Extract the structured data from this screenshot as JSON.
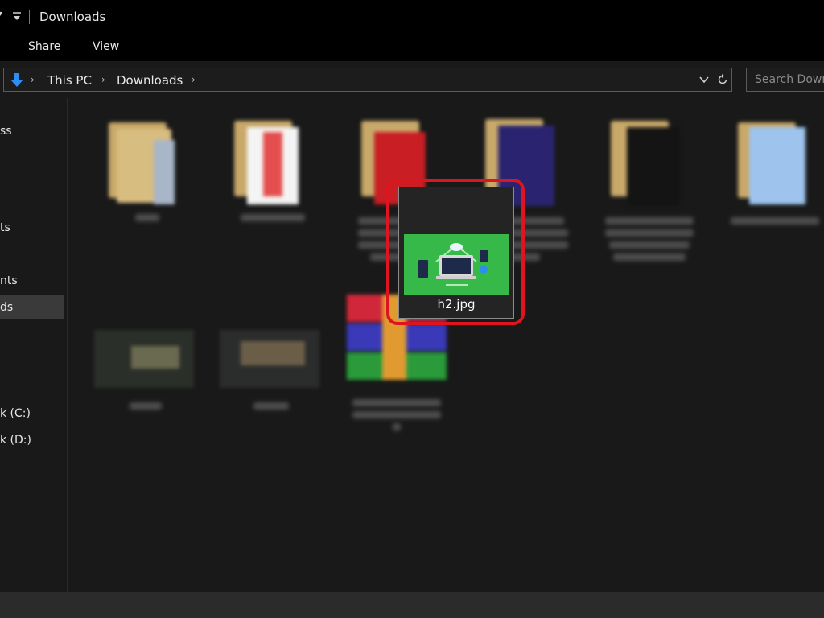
{
  "window": {
    "title": "Downloads"
  },
  "ribbon": {
    "tabs": [
      {
        "label": "Share"
      },
      {
        "label": "View"
      }
    ]
  },
  "address": {
    "breadcrumbs": [
      {
        "label": "This PC"
      },
      {
        "label": "Downloads"
      }
    ],
    "search_placeholder": "Search Downloads"
  },
  "nav": {
    "items": [
      {
        "label": "ss"
      },
      {
        "label": "ts"
      },
      {
        "label": "nts"
      },
      {
        "label": "ds",
        "selected": true
      },
      {
        "label": "k (C:)"
      },
      {
        "label": "k (D:)"
      }
    ]
  },
  "files": {
    "selected": {
      "name": "h2.jpg"
    }
  },
  "colors": {
    "highlight_frame": "#e0141e",
    "folder": "#e4c784",
    "thumbnail_green": "#37b94a",
    "accent_blue": "#2e8ef0"
  }
}
